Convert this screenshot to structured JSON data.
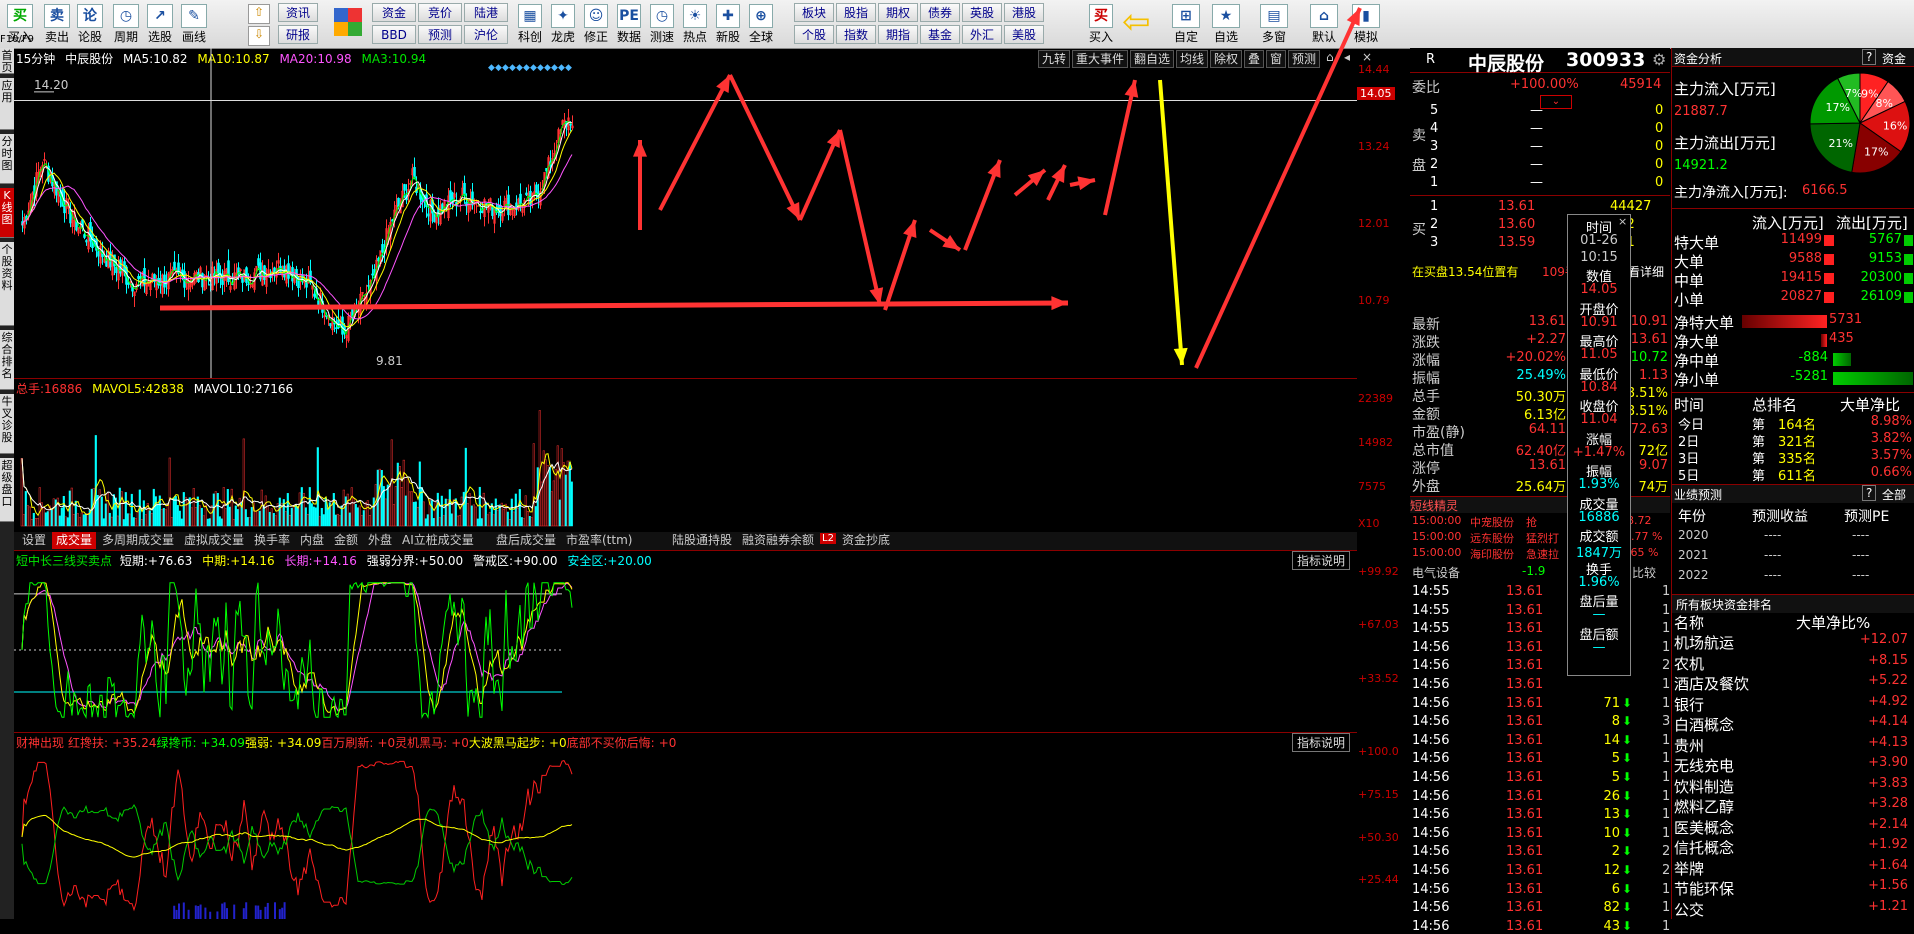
{
  "toolbar": {
    "main": [
      "买入",
      "卖出",
      "论股",
      "周期",
      "选股",
      "画线"
    ],
    "mid_top": [
      "资讯"
    ],
    "mid_bottom": [
      "研报"
    ],
    "small_top": [
      "资金",
      "竞价",
      "陆港"
    ],
    "small_bottom": [
      "BBD",
      "预测",
      "沪伦"
    ],
    "icons2": [
      "科创",
      "龙虎",
      "修正",
      "数据",
      "测速",
      "热点",
      "新股",
      "全球"
    ],
    "small2_top": [
      "板块",
      "股指",
      "期权",
      "债券",
      "英股",
      "港股"
    ],
    "small2_bottom": [
      "个股",
      "指数",
      "期指",
      "基金",
      "外汇",
      "美股"
    ],
    "right": [
      "买入",
      "自定",
      "自选",
      "多窗",
      "默认",
      "模拟"
    ]
  },
  "left_tabs": [
    "首页",
    "应用",
    "分时图",
    "K线图",
    "个股资料",
    "综合排名",
    "牛叉诊股",
    "超级盘口"
  ],
  "f10": "F10/F9",
  "kline": {
    "period": "15分钟",
    "name": "中辰股份",
    "ma5_label": "MA5:",
    "ma5": "10.82",
    "ma10_label": "MA10:",
    "ma10": "10.87",
    "ma20_label": "MA20:",
    "ma20": "10.98",
    "ma3_label": "MA3:",
    "ma3": "10.94",
    "buttons": [
      "九转",
      "重大事件",
      "翻自选",
      "均线",
      "除权",
      "叠",
      "窗",
      "预测"
    ],
    "hi_mark": "14.20",
    "lo_mark": "9.81",
    "axis": [
      "14.44",
      "13.24",
      "12.01",
      "10.79"
    ],
    "cur_price": "14.05"
  },
  "volume": {
    "total_label": "总手:",
    "total": "16886",
    "mavol5_label": "MAVOL5:",
    "mavol5": "42838",
    "mavol10_label": "MAVOL10:",
    "mavol10": "27166",
    "axis": [
      "22389",
      "14982",
      "7575",
      "X10"
    ],
    "tabs": [
      "设置",
      "成交量",
      "多周期成交量",
      "虚拟成交量",
      "换手率",
      "内盘",
      "金额",
      "外盘",
      "AI立桩成交量",
      "盘后成交量",
      "市盈率(ttm)",
      "陆股通持股",
      "融资融券余额",
      "资金抄底"
    ],
    "l2": "L2"
  },
  "ind1": {
    "name": "短中长三线买卖点",
    "short_label": "短期:",
    "short": "+76.63",
    "mid_label": "中期:",
    "mid": "+14.16",
    "long_label": "长期:",
    "long": "+14.16",
    "qr_label": "强弱分界:",
    "qr": "+50.00",
    "jj_label": "警戒区:",
    "jj": "+90.00",
    "aq_label": "安全区:",
    "aq": "+20.00",
    "btn": "指标说明",
    "axis": [
      "+99.92",
      "+67.03",
      "+33.52"
    ]
  },
  "ind2": {
    "items": [
      "财神出现",
      "红搀扶:",
      "+35.24",
      "绿搀币:",
      "+34.09",
      "强弱:",
      "+34.09",
      "百万刷新:",
      "+0",
      "灵机黑马:",
      "+0",
      "大波黑马起步:",
      "+0",
      "底部不买你后悔:",
      "+0"
    ],
    "btn": "指标说明",
    "axis": [
      "+100.0",
      "+75.15",
      "+50.30",
      "+25.44"
    ]
  },
  "stock": {
    "flag": "R",
    "name": "中辰股份",
    "code": "300933"
  },
  "order": {
    "wb_label": "委比",
    "wb": "+100.00%",
    "wb_val": "45914",
    "sell_label": "卖盘",
    "sell": [
      [
        "5",
        "—",
        "0"
      ],
      [
        "4",
        "—",
        "0"
      ],
      [
        "3",
        "—",
        "0"
      ],
      [
        "2",
        "—",
        "0"
      ],
      [
        "1",
        "—",
        "0"
      ]
    ],
    "buy_label": "买",
    "buy": [
      [
        "1",
        "13.61",
        "44427"
      ],
      [
        "2",
        "13.60",
        "812"
      ],
      [
        "3",
        "13.59",
        "331"
      ]
    ],
    "zt_note": "在买盘13.54位置有",
    "zt_qty": "109手",
    "zt_btn": "买单",
    "detail": "查看详细"
  },
  "quote": {
    "rows": [
      [
        "最新",
        "13.61",
        "开盘",
        "10.91"
      ],
      [
        "涨跌",
        "+2.27",
        "最高",
        "13.61"
      ],
      [
        "涨幅",
        "+20.02%",
        "最低",
        "10.72"
      ],
      [
        "振幅",
        "25.49%",
        "量比",
        "1.13"
      ],
      [
        "总手",
        "50.30万",
        "换手",
        "8.51%"
      ],
      [
        "金额",
        "6.13亿",
        "换手",
        "8.51%"
      ],
      [
        "市盈(静)",
        "64.11",
        "市盈",
        "72.63"
      ],
      [
        "总市值",
        "62.40亿",
        "流通",
        "72亿"
      ],
      [
        "涨停",
        "13.61",
        "跌停",
        "9.07"
      ],
      [
        "外盘",
        "25.64万",
        "内盘",
        "74万"
      ]
    ]
  },
  "tooltip": {
    "items": [
      [
        "时间",
        "white"
      ],
      [
        "01-26",
        "gray"
      ],
      [
        "10:15",
        "gray"
      ],
      [
        "数值",
        "white"
      ],
      [
        "14.05",
        "red"
      ],
      [
        "开盘价",
        "white"
      ],
      [
        "10.91",
        "red"
      ],
      [
        "最高价",
        "white"
      ],
      [
        "11.05",
        "red"
      ],
      [
        "最低价",
        "white"
      ],
      [
        "10.84",
        "red"
      ],
      [
        "收盘价",
        "white"
      ],
      [
        "11.04",
        "red"
      ],
      [
        "涨幅",
        "white"
      ],
      [
        "+1.47%",
        "red"
      ],
      [
        "振幅",
        "white"
      ],
      [
        "1.93%",
        "cyan"
      ],
      [
        "成交量",
        "white"
      ],
      [
        "16886",
        "cyan"
      ],
      [
        "成交额",
        "white"
      ],
      [
        "1847万",
        "cyan"
      ],
      [
        "换手",
        "white"
      ],
      [
        "1.96%",
        "cyan"
      ],
      [
        "盘后量",
        "white"
      ],
      [
        "—",
        "cyan"
      ],
      [
        "盘后额",
        "white"
      ],
      [
        "—",
        "cyan"
      ]
    ],
    "close": "×"
  },
  "jingling": {
    "title": "短线精灵",
    "rows": [
      [
        "15:00:00",
        "中宠股份",
        "抢",
        "48.72"
      ],
      [
        "15:00:00",
        "远东股份",
        "猛烈打",
        "-2.77 %"
      ],
      [
        "15:00:00",
        "海印股份",
        "急速拉",
        "2.65 %"
      ]
    ],
    "sector": "电气设备",
    "sector_val": "-1.9",
    "sector_btn": "比较"
  },
  "ticks": {
    "rows": [
      [
        "14:55",
        "13.61",
        "",
        "1"
      ],
      [
        "14:55",
        "13.61",
        "",
        "1"
      ],
      [
        "14:55",
        "13.61",
        "",
        "1"
      ],
      [
        "14:56",
        "13.61",
        "",
        "1"
      ],
      [
        "14:56",
        "13.61",
        "",
        "2"
      ],
      [
        "14:56",
        "13.61",
        "",
        "1"
      ],
      [
        "14:56",
        "13.61",
        "71",
        "1"
      ],
      [
        "14:56",
        "13.61",
        "8",
        "3"
      ],
      [
        "14:56",
        "13.61",
        "14",
        "1"
      ],
      [
        "14:56",
        "13.61",
        "5",
        "1"
      ],
      [
        "14:56",
        "13.61",
        "5",
        "1"
      ],
      [
        "14:56",
        "13.61",
        "26",
        "1"
      ],
      [
        "14:56",
        "13.61",
        "13",
        "1"
      ],
      [
        "14:56",
        "13.61",
        "10",
        "1"
      ],
      [
        "14:56",
        "13.61",
        "2",
        "2"
      ],
      [
        "14:56",
        "13.61",
        "12",
        "2"
      ],
      [
        "14:56",
        "13.61",
        "6",
        "1"
      ],
      [
        "14:56",
        "13.61",
        "82",
        "1"
      ],
      [
        "14:56",
        "13.61",
        "43",
        "1"
      ]
    ]
  },
  "fund": {
    "title": "资金分析",
    "help": "?",
    "collapse": "资金",
    "in_label": "主力流入[万元]",
    "in_val": "21887.7",
    "out_label": "主力流出[万元]",
    "out_val": "14921.2",
    "net_label": "主力净流入[万元]:",
    "net_val": "6166.5",
    "pie": [
      [
        "9%",
        "#ff2222"
      ],
      [
        "8%",
        "#ff5555"
      ],
      [
        "16%",
        "#dd1111"
      ],
      [
        "17%",
        "#880000"
      ],
      [
        "21%",
        "#006600"
      ],
      [
        "17%",
        "#009900"
      ],
      [
        "7%",
        "#22bb22"
      ]
    ],
    "table_head": [
      "",
      "流入[万元]",
      "流出[万元]"
    ],
    "table": [
      [
        "特大单",
        "11499",
        "5767"
      ],
      [
        "大单",
        "9588",
        "9153"
      ],
      [
        "中单",
        "19415",
        "20300"
      ],
      [
        "小单",
        "20827",
        "26109"
      ]
    ],
    "net": [
      [
        "净特大单",
        "5731",
        "pos"
      ],
      [
        "净大单",
        "435",
        "pos"
      ],
      [
        "净中单",
        "-884",
        "neg"
      ],
      [
        "净小单",
        "-5281",
        "neg"
      ]
    ],
    "rank_head": [
      "时间",
      "总排名",
      "大单净比"
    ],
    "rank": [
      [
        "今日",
        "第",
        "164名",
        "8.98%"
      ],
      [
        "2日",
        "第",
        "321名",
        "3.82%"
      ],
      [
        "3日",
        "第",
        "335名",
        "3.57%"
      ],
      [
        "5日",
        "第",
        "611名",
        "0.66%"
      ]
    ],
    "forecast_title": "业绩预测",
    "forecast_help": "?",
    "forecast_all": "全部",
    "forecast_head": [
      "年份",
      "预测收益",
      "预测PE"
    ],
    "forecast": [
      [
        "2020",
        "----",
        "----"
      ],
      [
        "2021",
        "----",
        "----"
      ],
      [
        "2022",
        "----",
        "----"
      ]
    ],
    "sector_title": "所有板块资金排名",
    "sector_head": [
      "名称",
      "大单净比%"
    ],
    "sectors": [
      [
        "机场航运",
        "+12.07"
      ],
      [
        "农机",
        "+8.15"
      ],
      [
        "酒店及餐饮",
        "+5.22"
      ],
      [
        "银行",
        "+4.92"
      ],
      [
        "白酒概念",
        "+4.14"
      ],
      [
        "贵州",
        "+4.13"
      ],
      [
        "无线充电",
        "+3.90"
      ],
      [
        "饮料制造",
        "+3.83"
      ],
      [
        "燃料乙醇",
        "+3.28"
      ],
      [
        "医美概念",
        "+2.14"
      ],
      [
        "信托概念",
        "+1.92"
      ],
      [
        "举牌",
        "+1.64"
      ],
      [
        "节能环保",
        "+1.56"
      ],
      [
        "公交",
        "+1.21"
      ]
    ]
  },
  "colors": {
    "up": "#ff3232",
    "down": "#00ffff",
    "accent": "#ff2020",
    "arrow": "#ff3333",
    "yellow": "#ffff00"
  }
}
